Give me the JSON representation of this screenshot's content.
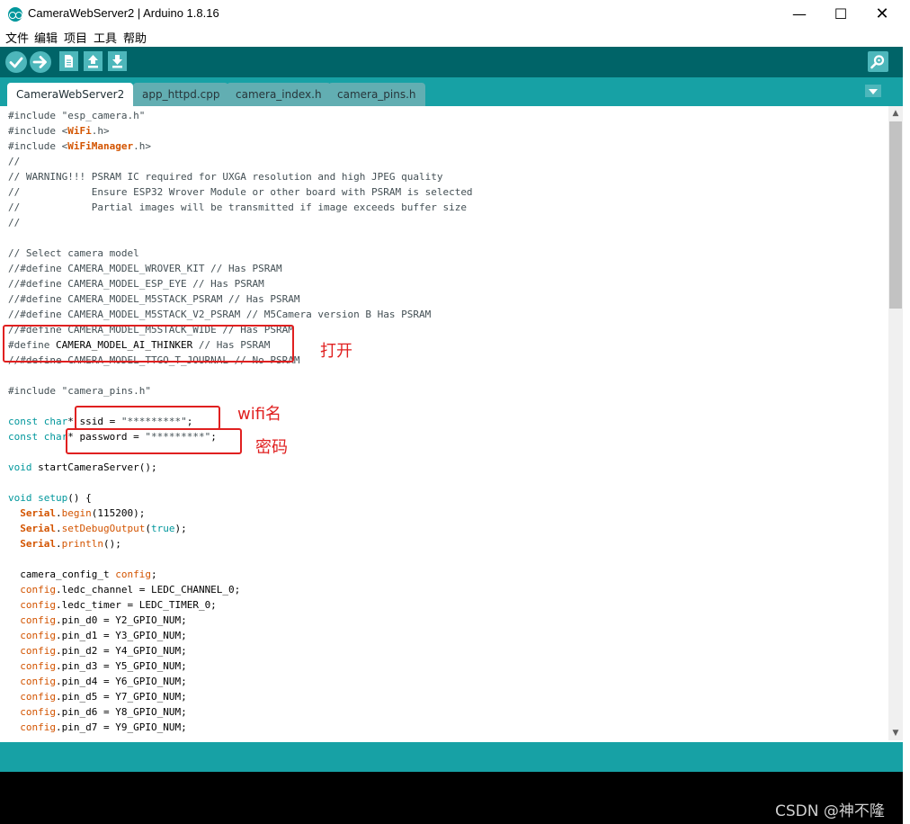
{
  "window": {
    "title": "CameraWebServer2 | Arduino 1.8.16",
    "minimize": "—",
    "maximize": "☐",
    "close": "✕"
  },
  "menu": [
    "文件",
    "编辑",
    "项目",
    "工具",
    "帮助"
  ],
  "toolbar": {
    "buttons": [
      "verify-icon",
      "upload-icon",
      "new-icon",
      "open-icon",
      "save-icon"
    ],
    "serial_monitor": "serial-monitor-icon"
  },
  "tabs": [
    "CameraWebServer2",
    "app_httpd.cpp",
    "camera_index.h",
    "camera_pins.h"
  ],
  "code": [
    [
      {
        "t": "#include ",
        "c": "pp"
      },
      {
        "t": "\"esp_camera.h\"",
        "c": "pp"
      }
    ],
    [
      {
        "t": "#include <",
        "c": "pp"
      },
      {
        "t": "WiFi",
        "c": "bi"
      },
      {
        "t": ".h>",
        "c": "pp"
      }
    ],
    [
      {
        "t": "#include <",
        "c": "pp"
      },
      {
        "t": "WiFiManager",
        "c": "bi"
      },
      {
        "t": ".h>",
        "c": "pp"
      }
    ],
    [
      {
        "t": "//",
        "c": "cm"
      }
    ],
    [
      {
        "t": "// WARNING!!! PSRAM IC required for UXGA resolution and high JPEG quality",
        "c": "cm"
      }
    ],
    [
      {
        "t": "//            Ensure ESP32 Wrover Module or other board with PSRAM is selected",
        "c": "cm"
      }
    ],
    [
      {
        "t": "//            Partial images will be transmitted if image exceeds buffer size",
        "c": "cm"
      }
    ],
    [
      {
        "t": "//",
        "c": "cm"
      }
    ],
    [],
    [
      {
        "t": "// Select camera model",
        "c": "cm"
      }
    ],
    [
      {
        "t": "//#define CAMERA_MODEL_WROVER_KIT // Has PSRAM",
        "c": "cm"
      }
    ],
    [
      {
        "t": "//#define CAMERA_MODEL_ESP_EYE // Has PSRAM",
        "c": "cm"
      }
    ],
    [
      {
        "t": "//#define CAMERA_MODEL_M5STACK_PSRAM // Has PSRAM",
        "c": "cm"
      }
    ],
    [
      {
        "t": "//#define CAMERA_MODEL_M5STACK_V2_PSRAM // M5Camera version B Has PSRAM",
        "c": "cm"
      }
    ],
    [
      {
        "t": "//#define CAMERA_MODEL_M5STACK_WIDE // Has PSRAM",
        "c": "cm"
      }
    ],
    [
      {
        "t": "#define ",
        "c": "pp"
      },
      {
        "t": "CAMERA_MODEL_AI_THINKER",
        "c": ""
      },
      {
        "t": " // Has PSRAM",
        "c": "cm"
      }
    ],
    [
      {
        "t": "//#define CAMERA_MODEL_TTGO_T_JOURNAL // No PSRAM",
        "c": "cm"
      }
    ],
    [],
    [
      {
        "t": "#include ",
        "c": "pp"
      },
      {
        "t": "\"camera_pins.h\"",
        "c": "pp"
      }
    ],
    [],
    [
      {
        "t": "const ",
        "c": "kw"
      },
      {
        "t": "char",
        "c": "kw"
      },
      {
        "t": "* ssid = ",
        "c": ""
      },
      {
        "t": "\"*********\"",
        "c": "pp"
      },
      {
        "t": ";",
        "c": ""
      }
    ],
    [
      {
        "t": "const ",
        "c": "kw"
      },
      {
        "t": "char",
        "c": "kw"
      },
      {
        "t": "* password = ",
        "c": ""
      },
      {
        "t": "\"*********\"",
        "c": "pp"
      },
      {
        "t": ";",
        "c": ""
      }
    ],
    [],
    [
      {
        "t": "void ",
        "c": "kw"
      },
      {
        "t": "startCameraServer();",
        "c": ""
      }
    ],
    [],
    [
      {
        "t": "void ",
        "c": "kw"
      },
      {
        "t": "setup",
        "c": "kw"
      },
      {
        "t": "() {",
        "c": ""
      }
    ],
    [
      {
        "t": "  ",
        "c": ""
      },
      {
        "t": "Serial",
        "c": "bi"
      },
      {
        "t": ".",
        "c": ""
      },
      {
        "t": "begin",
        "c": "fn"
      },
      {
        "t": "(115200);",
        "c": ""
      }
    ],
    [
      {
        "t": "  ",
        "c": ""
      },
      {
        "t": "Serial",
        "c": "bi"
      },
      {
        "t": ".",
        "c": ""
      },
      {
        "t": "setDebugOutput",
        "c": "fn"
      },
      {
        "t": "(",
        "c": ""
      },
      {
        "t": "true",
        "c": "kw"
      },
      {
        "t": ");",
        "c": ""
      }
    ],
    [
      {
        "t": "  ",
        "c": ""
      },
      {
        "t": "Serial",
        "c": "bi"
      },
      {
        "t": ".",
        "c": ""
      },
      {
        "t": "println",
        "c": "fn"
      },
      {
        "t": "();",
        "c": ""
      }
    ],
    [],
    [
      {
        "t": "  camera_config_t ",
        "c": ""
      },
      {
        "t": "config",
        "c": "fn"
      },
      {
        "t": ";",
        "c": ""
      }
    ],
    [
      {
        "t": "  ",
        "c": ""
      },
      {
        "t": "config",
        "c": "fn"
      },
      {
        "t": ".ledc_channel = LEDC_CHANNEL_0;",
        "c": ""
      }
    ],
    [
      {
        "t": "  ",
        "c": ""
      },
      {
        "t": "config",
        "c": "fn"
      },
      {
        "t": ".ledc_timer = LEDC_TIMER_0;",
        "c": ""
      }
    ],
    [
      {
        "t": "  ",
        "c": ""
      },
      {
        "t": "config",
        "c": "fn"
      },
      {
        "t": ".pin_d0 = Y2_GPIO_NUM;",
        "c": ""
      }
    ],
    [
      {
        "t": "  ",
        "c": ""
      },
      {
        "t": "config",
        "c": "fn"
      },
      {
        "t": ".pin_d1 = Y3_GPIO_NUM;",
        "c": ""
      }
    ],
    [
      {
        "t": "  ",
        "c": ""
      },
      {
        "t": "config",
        "c": "fn"
      },
      {
        "t": ".pin_d2 = Y4_GPIO_NUM;",
        "c": ""
      }
    ],
    [
      {
        "t": "  ",
        "c": ""
      },
      {
        "t": "config",
        "c": "fn"
      },
      {
        "t": ".pin_d3 = Y5_GPIO_NUM;",
        "c": ""
      }
    ],
    [
      {
        "t": "  ",
        "c": ""
      },
      {
        "t": "config",
        "c": "fn"
      },
      {
        "t": ".pin_d4 = Y6_GPIO_NUM;",
        "c": ""
      }
    ],
    [
      {
        "t": "  ",
        "c": ""
      },
      {
        "t": "config",
        "c": "fn"
      },
      {
        "t": ".pin_d5 = Y7_GPIO_NUM;",
        "c": ""
      }
    ],
    [
      {
        "t": "  ",
        "c": ""
      },
      {
        "t": "config",
        "c": "fn"
      },
      {
        "t": ".pin_d6 = Y8_GPIO_NUM;",
        "c": ""
      }
    ],
    [
      {
        "t": "  ",
        "c": ""
      },
      {
        "t": "config",
        "c": "fn"
      },
      {
        "t": ".pin_d7 = Y9_GPIO_NUM;",
        "c": ""
      }
    ]
  ],
  "annotations": {
    "open": "打开",
    "wifi_name": "wifi名",
    "password": "密码"
  },
  "colors": {
    "toolbar": "#006468",
    "tabbar": "#17a1a5",
    "annotation": "#e02020"
  },
  "watermark": "CSDN @神不隆"
}
